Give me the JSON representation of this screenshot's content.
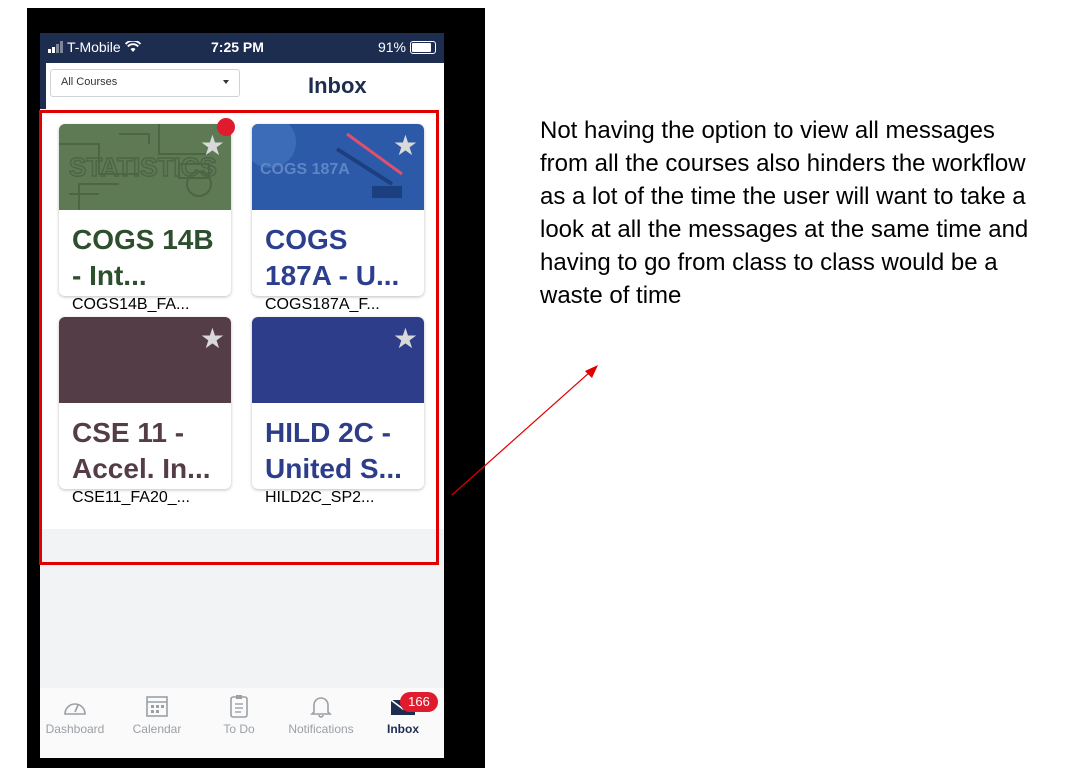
{
  "status_bar": {
    "carrier": "T-Mobile",
    "time": "7:25 PM",
    "battery": "91%"
  },
  "header": {
    "course_filter": "All Courses",
    "title": "Inbox"
  },
  "courses": [
    {
      "name": "COGS 14B - Int...",
      "code": "COGS14B_FA...",
      "banner_color": "#5e7a55",
      "banner_text": "STATISTICS",
      "unread": true
    },
    {
      "name": "COGS 187A - U...",
      "code": "COGS187A_F...",
      "banner_color": "#2c5aa8",
      "banner_text": "COGS 187A",
      "unread": false
    },
    {
      "name": "CSE 11 - Accel. In...",
      "code": "CSE11_FA20_...",
      "banner_color": "#553d48",
      "unread": false
    },
    {
      "name": "HILD 2C - United S...",
      "code": "HILD2C_SP2...",
      "banner_color": "#2d3d8a",
      "unread": false
    }
  ],
  "tabs": [
    {
      "label": "Dashboard",
      "icon": "dashboard-icon"
    },
    {
      "label": "Calendar",
      "icon": "calendar-icon"
    },
    {
      "label": "To Do",
      "icon": "todo-icon"
    },
    {
      "label": "Notifications",
      "icon": "bell-icon"
    },
    {
      "label": "Inbox",
      "icon": "inbox-icon"
    }
  ],
  "inbox_badge": "166",
  "annotation": "Not having the option to view all messages from all the courses also hinders the workflow as a lot of the time the user will want to take a look at all the messages at the same time and having to go from class to class would be a waste of time",
  "colors": {
    "navy": "#1d2d50",
    "alert_red": "#e01b2d",
    "highlight_red": "#e00000"
  }
}
